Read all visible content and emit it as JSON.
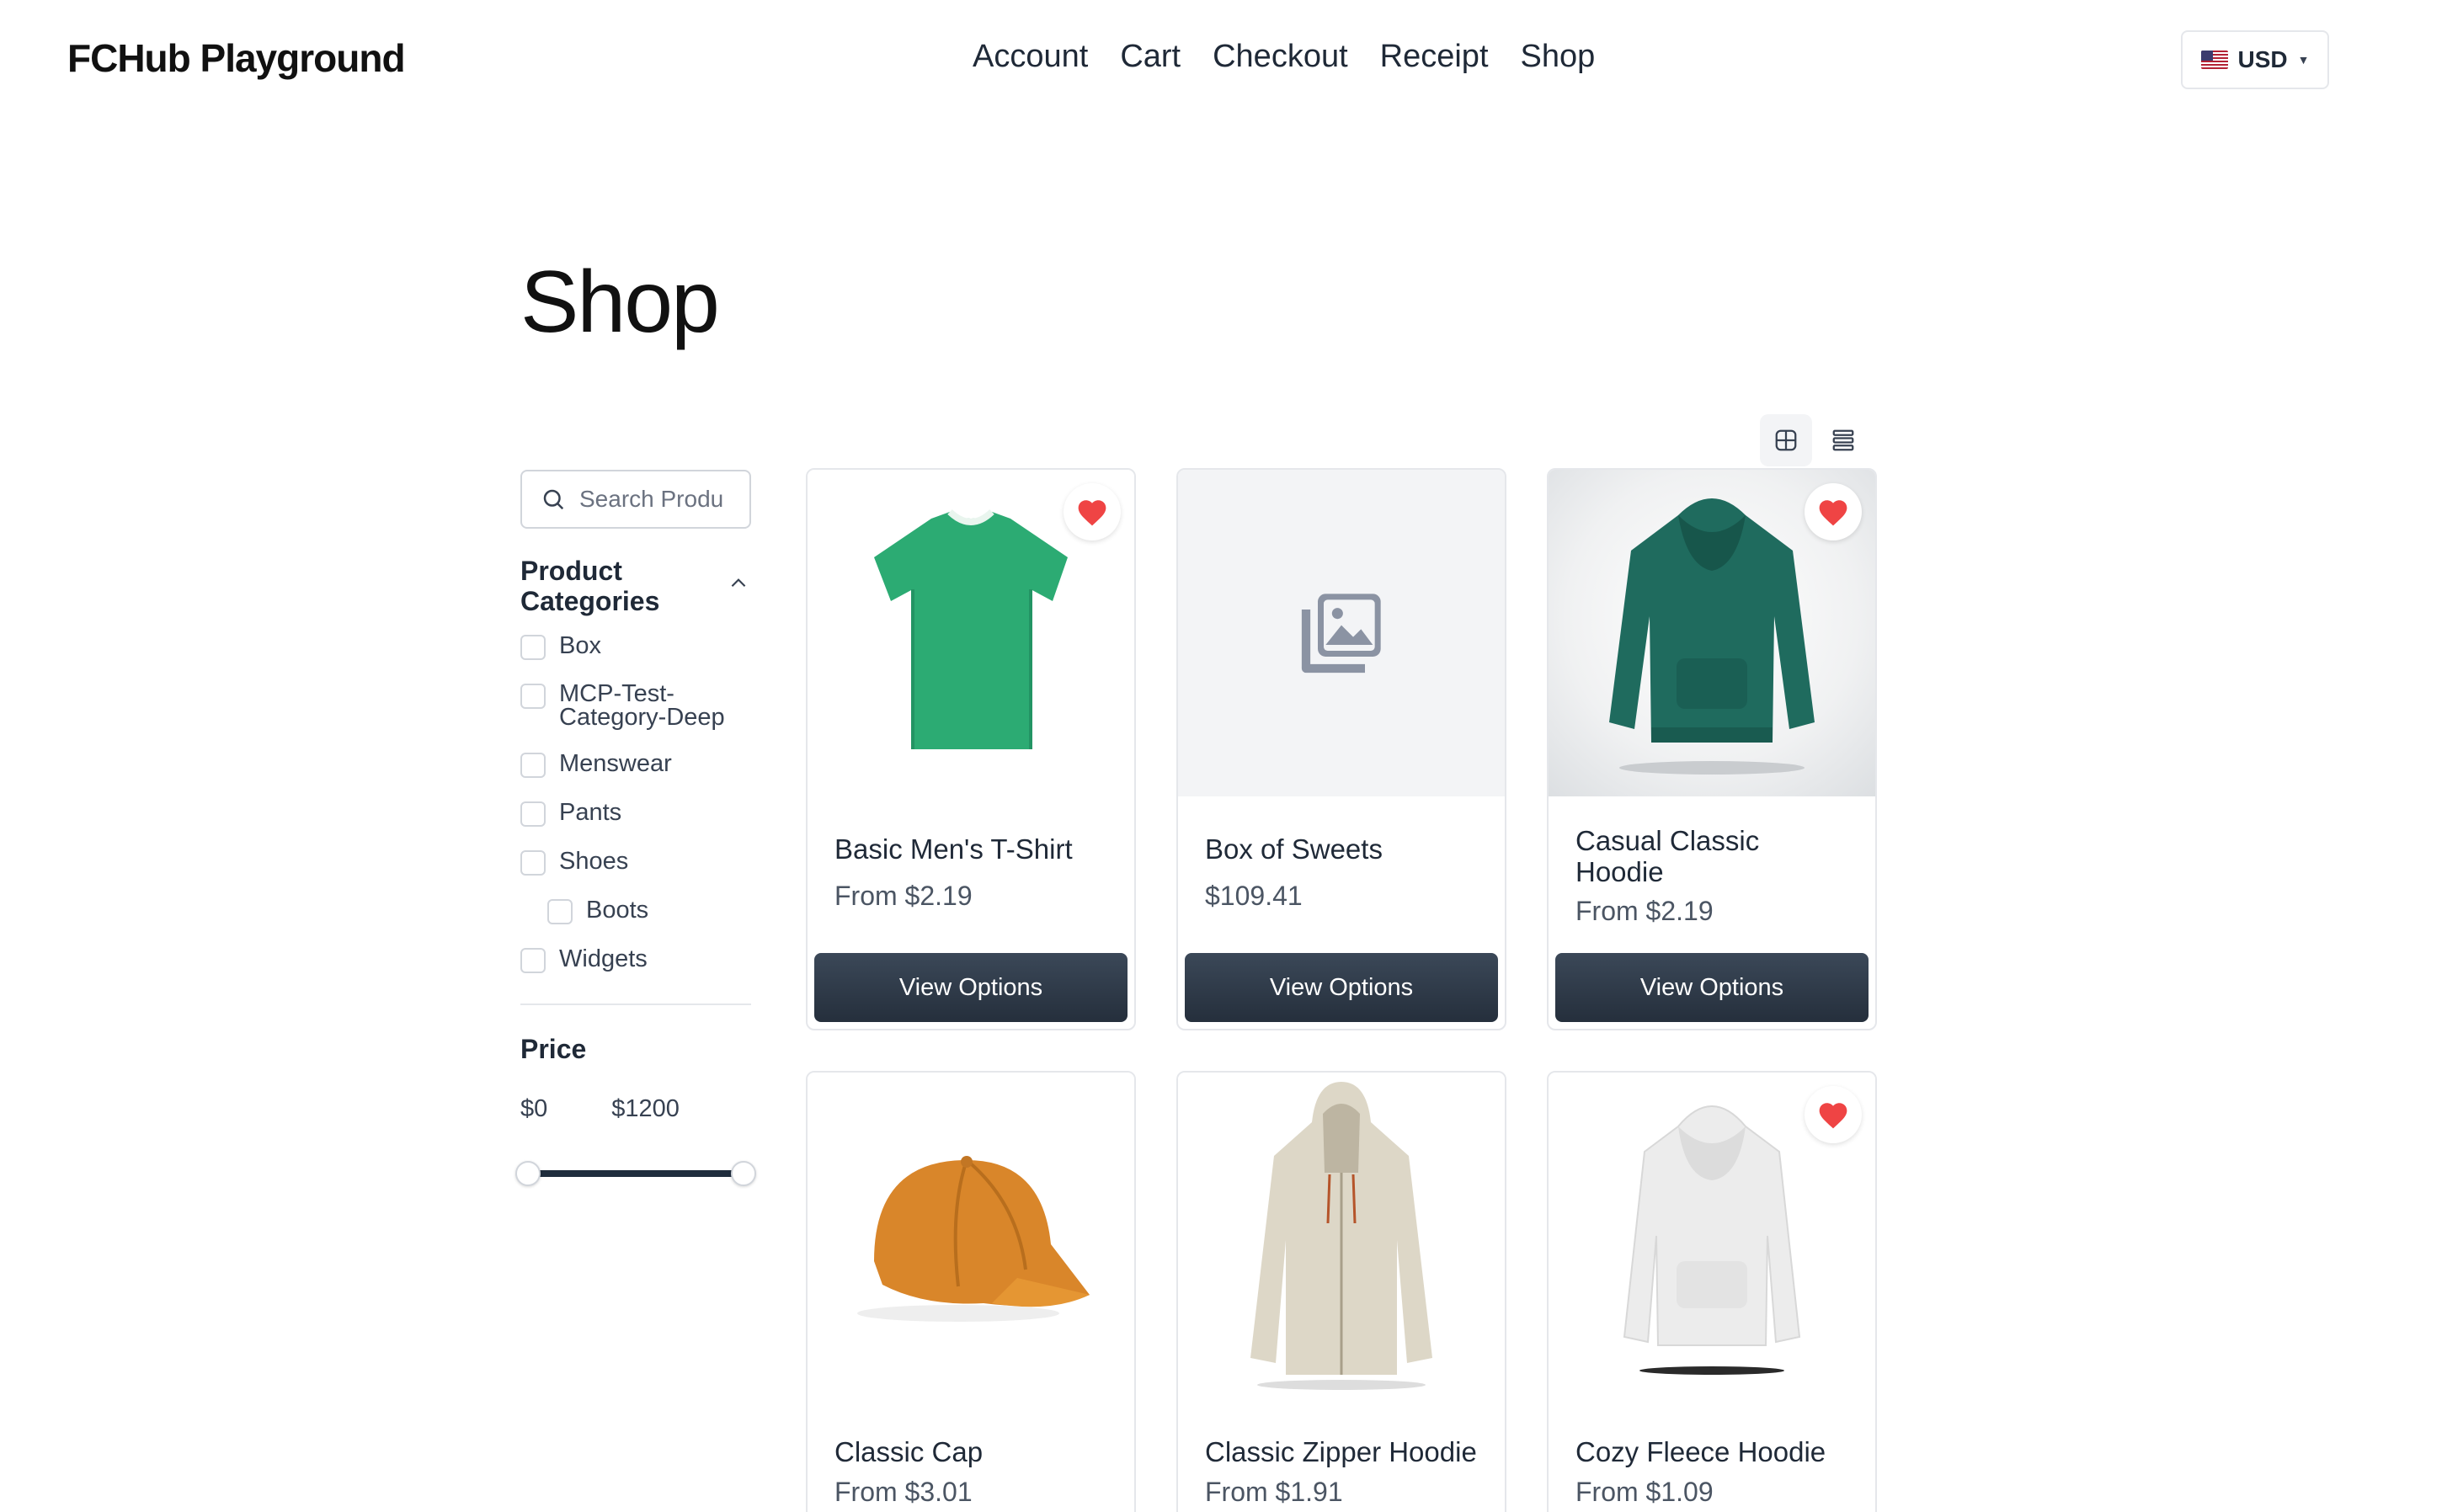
{
  "header": {
    "brand": "FCHub Playground",
    "nav": [
      "Account",
      "Cart",
      "Checkout",
      "Receipt",
      "Shop"
    ],
    "currency": {
      "code": "USD",
      "flag_icon": "us-flag-icon"
    }
  },
  "page_title": "Shop",
  "sidebar": {
    "search_placeholder": "Search Produ",
    "categories_title": "Product Categories",
    "categories": [
      {
        "label": "Box",
        "checked": false,
        "level": 0
      },
      {
        "label": "MCP-Test-Category-Deep",
        "checked": false,
        "level": 0
      },
      {
        "label": "Menswear",
        "checked": false,
        "level": 0
      },
      {
        "label": "Pants",
        "checked": false,
        "level": 0
      },
      {
        "label": "Shoes",
        "checked": false,
        "level": 0
      },
      {
        "label": "Boots",
        "checked": false,
        "level": 1
      },
      {
        "label": "Widgets",
        "checked": false,
        "level": 0
      }
    ],
    "price_title": "Price",
    "price_min": "$0",
    "price_max": "$1200"
  },
  "products": [
    {
      "name": "Basic Men's T-Shirt",
      "price": "From $2.19",
      "button": "View Options",
      "favorited": true,
      "image": "green-tshirt"
    },
    {
      "name": "Box of Sweets",
      "price": "$109.41",
      "button": "View Options",
      "favorited": false,
      "image": "placeholder-gallery-icon"
    },
    {
      "name": "Casual Classic Hoodie",
      "price": "From $2.19",
      "button": "View Options",
      "favorited": true,
      "image": "teal-hoodie"
    },
    {
      "name": "Classic Cap",
      "price": "From $3.01",
      "favorited": false,
      "image": "orange-cap"
    },
    {
      "name": "Classic Zipper Hoodie",
      "price": "From $1.91",
      "favorited": false,
      "image": "beige-zip-hoodie"
    },
    {
      "name": "Cozy Fleece Hoodie",
      "price": "From $1.09",
      "favorited": true,
      "image": "white-hoodie"
    }
  ],
  "colors": {
    "button": "#2b3644",
    "heart": "#ef4444",
    "border": "#e5e7eb"
  }
}
